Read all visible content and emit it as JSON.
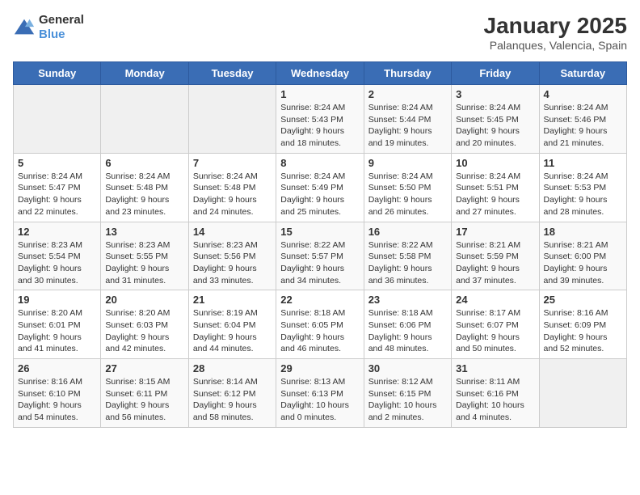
{
  "logo": {
    "general": "General",
    "blue": "Blue"
  },
  "title": "January 2025",
  "subtitle": "Palanques, Valencia, Spain",
  "days_of_week": [
    "Sunday",
    "Monday",
    "Tuesday",
    "Wednesday",
    "Thursday",
    "Friday",
    "Saturday"
  ],
  "weeks": [
    [
      {
        "day": "",
        "info": ""
      },
      {
        "day": "",
        "info": ""
      },
      {
        "day": "",
        "info": ""
      },
      {
        "day": "1",
        "info": "Sunrise: 8:24 AM\nSunset: 5:43 PM\nDaylight: 9 hours and 18 minutes."
      },
      {
        "day": "2",
        "info": "Sunrise: 8:24 AM\nSunset: 5:44 PM\nDaylight: 9 hours and 19 minutes."
      },
      {
        "day": "3",
        "info": "Sunrise: 8:24 AM\nSunset: 5:45 PM\nDaylight: 9 hours and 20 minutes."
      },
      {
        "day": "4",
        "info": "Sunrise: 8:24 AM\nSunset: 5:46 PM\nDaylight: 9 hours and 21 minutes."
      }
    ],
    [
      {
        "day": "5",
        "info": "Sunrise: 8:24 AM\nSunset: 5:47 PM\nDaylight: 9 hours and 22 minutes."
      },
      {
        "day": "6",
        "info": "Sunrise: 8:24 AM\nSunset: 5:48 PM\nDaylight: 9 hours and 23 minutes."
      },
      {
        "day": "7",
        "info": "Sunrise: 8:24 AM\nSunset: 5:48 PM\nDaylight: 9 hours and 24 minutes."
      },
      {
        "day": "8",
        "info": "Sunrise: 8:24 AM\nSunset: 5:49 PM\nDaylight: 9 hours and 25 minutes."
      },
      {
        "day": "9",
        "info": "Sunrise: 8:24 AM\nSunset: 5:50 PM\nDaylight: 9 hours and 26 minutes."
      },
      {
        "day": "10",
        "info": "Sunrise: 8:24 AM\nSunset: 5:51 PM\nDaylight: 9 hours and 27 minutes."
      },
      {
        "day": "11",
        "info": "Sunrise: 8:24 AM\nSunset: 5:53 PM\nDaylight: 9 hours and 28 minutes."
      }
    ],
    [
      {
        "day": "12",
        "info": "Sunrise: 8:23 AM\nSunset: 5:54 PM\nDaylight: 9 hours and 30 minutes."
      },
      {
        "day": "13",
        "info": "Sunrise: 8:23 AM\nSunset: 5:55 PM\nDaylight: 9 hours and 31 minutes."
      },
      {
        "day": "14",
        "info": "Sunrise: 8:23 AM\nSunset: 5:56 PM\nDaylight: 9 hours and 33 minutes."
      },
      {
        "day": "15",
        "info": "Sunrise: 8:22 AM\nSunset: 5:57 PM\nDaylight: 9 hours and 34 minutes."
      },
      {
        "day": "16",
        "info": "Sunrise: 8:22 AM\nSunset: 5:58 PM\nDaylight: 9 hours and 36 minutes."
      },
      {
        "day": "17",
        "info": "Sunrise: 8:21 AM\nSunset: 5:59 PM\nDaylight: 9 hours and 37 minutes."
      },
      {
        "day": "18",
        "info": "Sunrise: 8:21 AM\nSunset: 6:00 PM\nDaylight: 9 hours and 39 minutes."
      }
    ],
    [
      {
        "day": "19",
        "info": "Sunrise: 8:20 AM\nSunset: 6:01 PM\nDaylight: 9 hours and 41 minutes."
      },
      {
        "day": "20",
        "info": "Sunrise: 8:20 AM\nSunset: 6:03 PM\nDaylight: 9 hours and 42 minutes."
      },
      {
        "day": "21",
        "info": "Sunrise: 8:19 AM\nSunset: 6:04 PM\nDaylight: 9 hours and 44 minutes."
      },
      {
        "day": "22",
        "info": "Sunrise: 8:18 AM\nSunset: 6:05 PM\nDaylight: 9 hours and 46 minutes."
      },
      {
        "day": "23",
        "info": "Sunrise: 8:18 AM\nSunset: 6:06 PM\nDaylight: 9 hours and 48 minutes."
      },
      {
        "day": "24",
        "info": "Sunrise: 8:17 AM\nSunset: 6:07 PM\nDaylight: 9 hours and 50 minutes."
      },
      {
        "day": "25",
        "info": "Sunrise: 8:16 AM\nSunset: 6:09 PM\nDaylight: 9 hours and 52 minutes."
      }
    ],
    [
      {
        "day": "26",
        "info": "Sunrise: 8:16 AM\nSunset: 6:10 PM\nDaylight: 9 hours and 54 minutes."
      },
      {
        "day": "27",
        "info": "Sunrise: 8:15 AM\nSunset: 6:11 PM\nDaylight: 9 hours and 56 minutes."
      },
      {
        "day": "28",
        "info": "Sunrise: 8:14 AM\nSunset: 6:12 PM\nDaylight: 9 hours and 58 minutes."
      },
      {
        "day": "29",
        "info": "Sunrise: 8:13 AM\nSunset: 6:13 PM\nDaylight: 10 hours and 0 minutes."
      },
      {
        "day": "30",
        "info": "Sunrise: 8:12 AM\nSunset: 6:15 PM\nDaylight: 10 hours and 2 minutes."
      },
      {
        "day": "31",
        "info": "Sunrise: 8:11 AM\nSunset: 6:16 PM\nDaylight: 10 hours and 4 minutes."
      },
      {
        "day": "",
        "info": ""
      }
    ]
  ]
}
